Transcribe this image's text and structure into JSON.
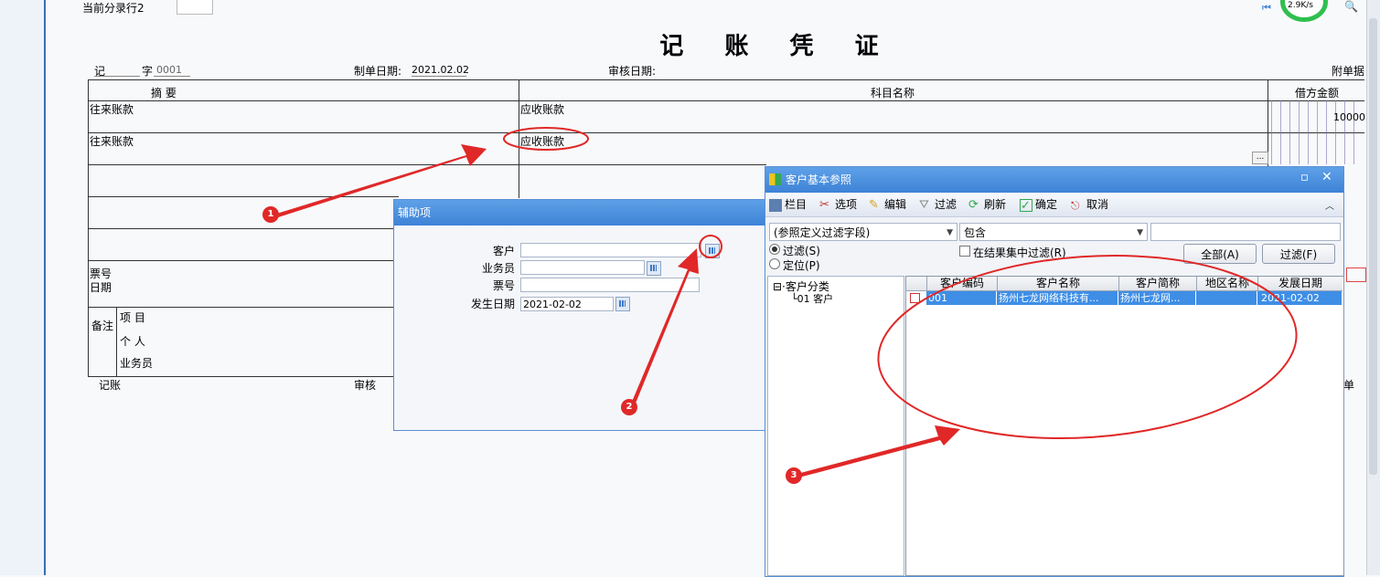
{
  "top": {
    "current_row": "当前分录行2",
    "net_speed": "2.9K/s"
  },
  "voucher": {
    "title": "记 账 凭 证",
    "type_label": "记",
    "num_label": "字",
    "num_value": "0001",
    "date_label": "制单日期:",
    "date_value": "2021.02.02",
    "audit_label": "审核日期:",
    "attach_label": "附单据",
    "col_summary": "摘 要",
    "col_account": "科目名称",
    "col_debit": "借方金额",
    "rows": [
      {
        "summary": "往来账款",
        "account": "应收账款",
        "debit": "10000"
      },
      {
        "summary": "往来账款",
        "account": "应收账款",
        "debit": ""
      }
    ],
    "bill_no_label": "票号",
    "bill_date_label": "日期",
    "remark_label": "备注",
    "project_label": "项 目",
    "person_label": "个 人",
    "salesman_label": "业务员",
    "bookkeeping_label": "记账",
    "auditor_label": "审核",
    "ellipsis": "...",
    "last_col": "单"
  },
  "aux_dialog": {
    "title": "辅助项",
    "fields": [
      {
        "label": "客户",
        "value": ""
      },
      {
        "label": "业务员",
        "value": ""
      },
      {
        "label": "票号",
        "value": ""
      },
      {
        "label": "发生日期",
        "value": "2021-02-02"
      }
    ]
  },
  "ref_dialog": {
    "title": "客户基本参照",
    "toolbar": [
      "栏目",
      "选项",
      "编辑",
      "过滤",
      "刷新",
      "确定",
      "取消"
    ],
    "filter_field": "(参照定义过滤字段)",
    "filter_op": "包含",
    "radio_filter": "过滤(S)",
    "radio_locate": "定位(P)",
    "check_in_result": "在结果集中过滤(R)",
    "btn_all": "全部(A)",
    "btn_filter": "过滤(F)",
    "tree_root": "客户分类",
    "tree_child": "01 客户",
    "columns": [
      "客户编码",
      "客户名称",
      "客户简称",
      "地区名称",
      "发展日期"
    ],
    "rows": [
      [
        "001",
        "扬州七龙网络科技有...",
        "扬州七龙网...",
        "",
        "2021-02-02"
      ]
    ]
  },
  "annotations": [
    "1",
    "2",
    "3"
  ],
  "colors": {
    "accent": "#3d82d6",
    "annotation": "#e02828",
    "selected_row": "#3e8ee6"
  }
}
